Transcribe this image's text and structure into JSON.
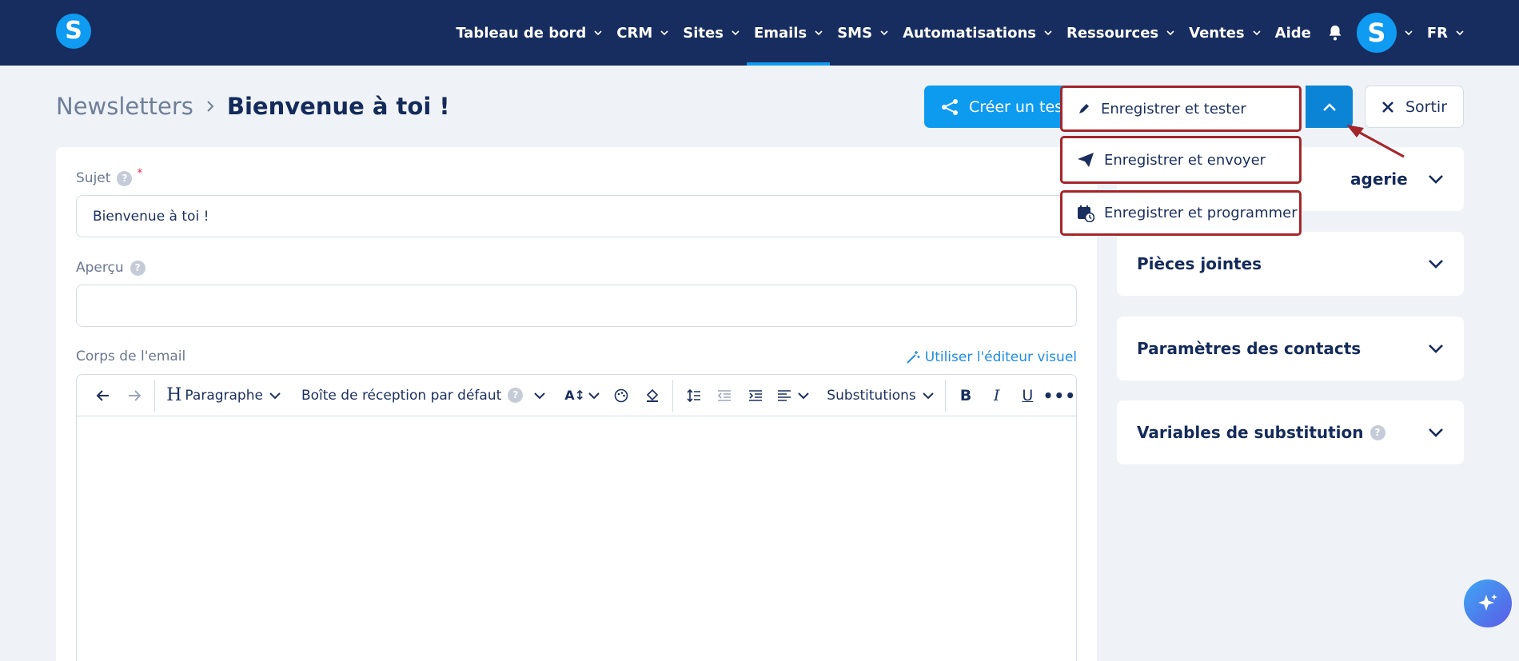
{
  "nav": {
    "logo": "S",
    "items": [
      {
        "label": "Tableau de bord",
        "dropdown": true
      },
      {
        "label": "CRM",
        "dropdown": true
      },
      {
        "label": "Sites",
        "dropdown": true
      },
      {
        "label": "Emails",
        "dropdown": true,
        "active": true
      },
      {
        "label": "SMS",
        "dropdown": true
      },
      {
        "label": "Automatisations",
        "dropdown": true
      },
      {
        "label": "Ressources",
        "dropdown": true
      },
      {
        "label": "Ventes",
        "dropdown": true
      },
      {
        "label": "Aide",
        "dropdown": false
      }
    ],
    "avatar": "S",
    "language": "FR"
  },
  "breadcrumb": {
    "parent": "Newsletters",
    "current": "Bienvenue à toi !"
  },
  "header_buttons": {
    "create_test": "Créer un test",
    "exit": "Sortir"
  },
  "dropdown_menu": [
    {
      "label": "Enregistrer et tester",
      "icon": "pen-icon"
    },
    {
      "label": "Enregistrer et envoyer",
      "icon": "paper-plane-icon"
    },
    {
      "label": "Enregistrer et programmer",
      "icon": "calendar-clock-icon"
    }
  ],
  "form": {
    "subject_label": "Sujet",
    "subject_value": "Bienvenue à toi !",
    "preview_label": "Aperçu",
    "preview_value": "",
    "body_label": "Corps de l'email",
    "visual_editor_link": "Utiliser l'éditeur visuel"
  },
  "toolbar": {
    "paragraph": "Paragraphe",
    "inbox": "Boîte de réception par défaut",
    "substitutions": "Substitutions"
  },
  "panels": [
    {
      "title": "agerie"
    },
    {
      "title": "Pièces jointes"
    },
    {
      "title": "Paramètres des contacts"
    },
    {
      "title": "Variables de substitution",
      "help": true
    }
  ],
  "colors": {
    "nav_bg": "#172d5f",
    "primary": "#0d9bf0",
    "highlight": "#a3262b"
  }
}
